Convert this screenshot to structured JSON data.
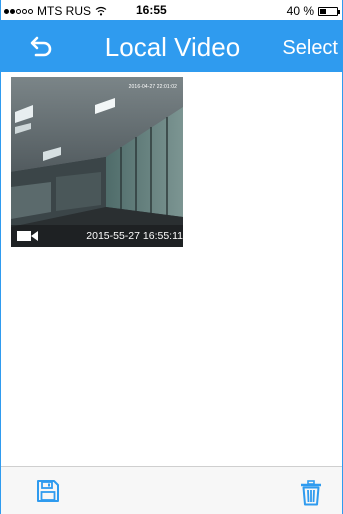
{
  "status_bar": {
    "carrier": "MTS RUS",
    "time": "16:55",
    "battery_percent": "40 %",
    "battery_level": 0.4,
    "signal_bars_on": 2,
    "signal_bars_total": 5
  },
  "nav": {
    "title": "Local Video",
    "select_label": "Select",
    "back_icon": "back-arrow-icon",
    "background_color": "#2f9bef"
  },
  "videos": [
    {
      "stamp": "2016-04-27 22:01:02",
      "date": "2015-55-27 16:55:11",
      "icon": "video-camera-icon"
    }
  ],
  "toolbar": {
    "save_icon": "floppy-disk-icon",
    "delete_icon": "trash-icon",
    "icon_color": "#2f9bef"
  }
}
